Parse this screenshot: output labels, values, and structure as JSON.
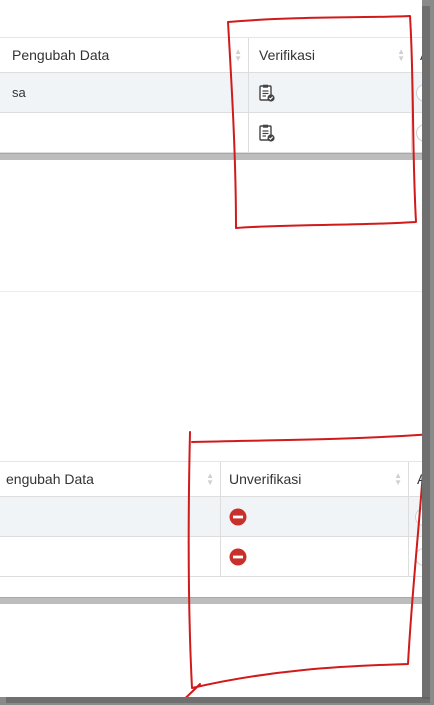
{
  "table_top": {
    "headers": {
      "pengubah": "Pengubah Data",
      "verifikasi": "Verifikasi",
      "aksi": "A"
    },
    "rows": [
      {
        "pengubah": "sa"
      },
      {
        "pengubah": ""
      }
    ]
  },
  "table_bottom": {
    "headers": {
      "pengubah": "engubah Data",
      "unverifikasi": "Unverifikasi",
      "aksi": "A"
    }
  },
  "icons": {
    "verify": "clipboard-check-icon",
    "unverify": "no-entry-icon"
  },
  "colors": {
    "annotation": "#d11a1a",
    "no_entry": "#c9302c",
    "row_alt": "#f1f4f6"
  }
}
